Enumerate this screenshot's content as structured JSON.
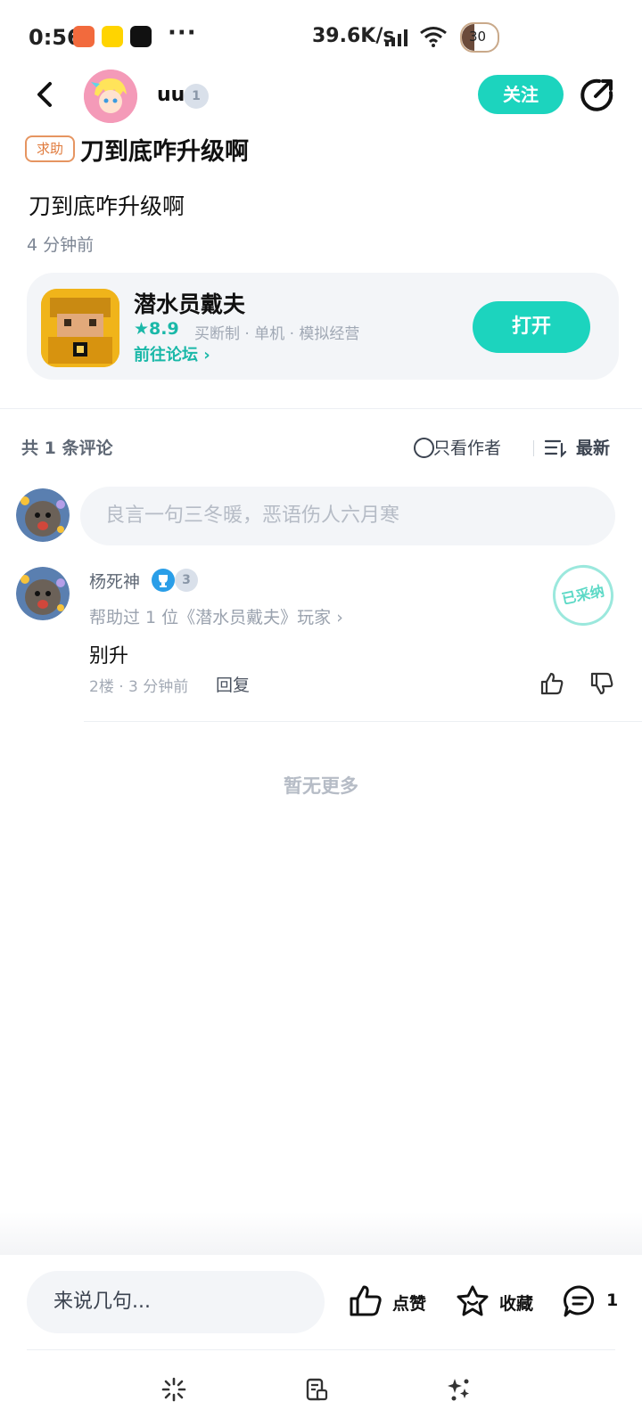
{
  "status_bar": {
    "time": "0:56",
    "more": "···",
    "net_speed": "39.6K/s",
    "battery": "30"
  },
  "header": {
    "username": "uu",
    "level": "1",
    "follow_label": "关注"
  },
  "post": {
    "tag": "求助",
    "title": "刀到底咋升级啊",
    "body": "刀到底咋升级啊",
    "time_ago": "4 分钟前"
  },
  "game": {
    "name": "潜水员戴夫",
    "rating": "★8.9",
    "meta": "买断制 · 单机 · 模拟经营",
    "forum_link": "前往论坛",
    "open_label": "打开"
  },
  "comments_bar": {
    "count_label": "共 1 条评论",
    "author_only": "只看作者",
    "sort_label": "最新"
  },
  "comment_input": {
    "placeholder": "良言一句三冬暖，恶语伤人六月寒"
  },
  "comment": {
    "name": "杨死神",
    "level": "3",
    "helped": "帮助过 1 位《潜水员戴夫》玩家 ",
    "accepted_stamp": "已采纳",
    "text": "别升",
    "meta": "2楼 · 3 分钟前",
    "reply_label": "回复"
  },
  "no_more": "暂无更多",
  "bottom": {
    "say_placeholder": "来说几句...",
    "like_label": "点赞",
    "fav_label": "收藏",
    "comment_count": "1"
  },
  "colors": {
    "accent": "#1cd4be",
    "tag_orange": "#e07b3d"
  }
}
